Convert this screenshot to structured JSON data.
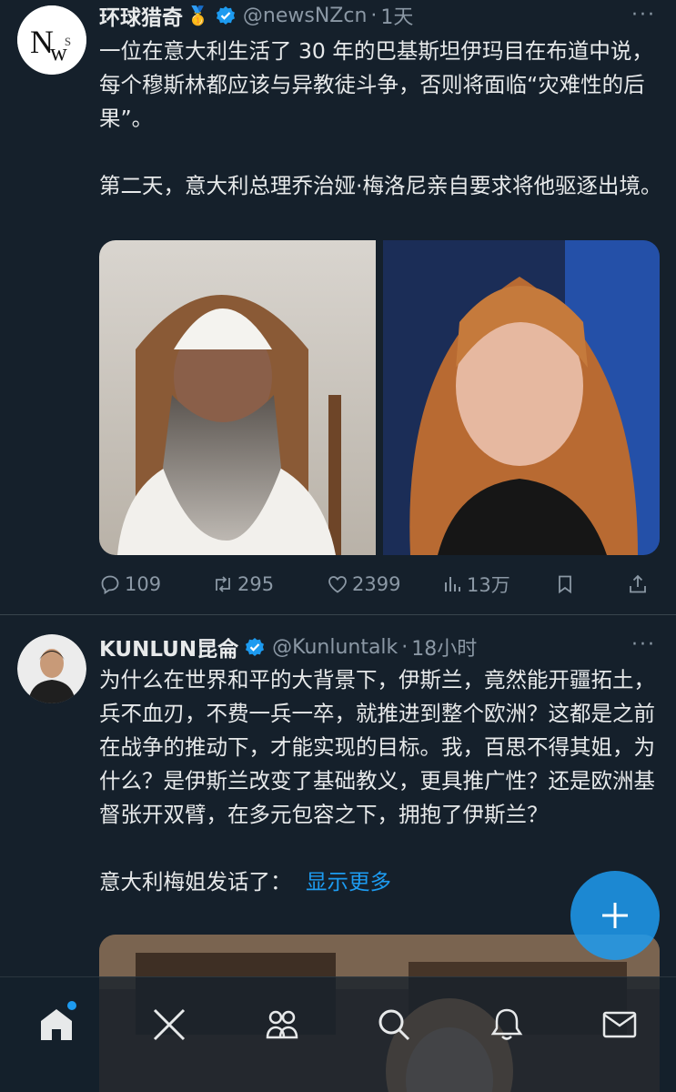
{
  "tweets": [
    {
      "name": "环球猎奇",
      "badge_emoji": "🥇",
      "handle": "@newsNZcn",
      "time": "1天",
      "more": "···",
      "paragraphs": [
        "一位在意大利生活了 30 年的巴基斯坦伊玛目在布道中说，每个穆斯林都应该与异教徒斗争，否则将面临“灾难性的后果”。",
        "第二天，意大利总理乔治娅·梅洛尼亲自要求将他驱逐出境。"
      ],
      "stats": {
        "replies": "109",
        "retweets": "295",
        "likes": "2399",
        "views": "13万"
      },
      "avatar_text": "N"
    },
    {
      "name": "KUNLUN昆侖",
      "handle": "@Kunluntalk",
      "time": "18小时",
      "more": "···",
      "paragraphs": [
        "为什么在世界和平的大背景下，伊斯兰，竟然能开疆拓土，兵不血刃，不费一兵一卒，就推进到整个欧洲？这都是之前在战争的推动下，才能实现的目标。我，百思不得其姐，为什么？是伊斯兰改变了基础教义，更具推广性？还是欧洲基督张开双臂，在多元包容之下，拥抱了伊斯兰？",
        "意大利梅姐发话了："
      ],
      "show_more": "显示更多"
    }
  ],
  "icons": {
    "reply": "reply-icon",
    "retweet": "retweet-icon",
    "like": "heart-icon",
    "views": "views-icon",
    "bookmark": "bookmark-icon",
    "share": "share-icon",
    "compose": "plus-icon",
    "nav": [
      "home-icon",
      "x-logo-icon",
      "communities-icon",
      "search-icon",
      "notifications-icon",
      "messages-icon"
    ]
  },
  "colors": {
    "background": "#15202b",
    "accent": "#1d9bf0",
    "muted": "#8b98a5",
    "text": "#e7e9ea"
  }
}
